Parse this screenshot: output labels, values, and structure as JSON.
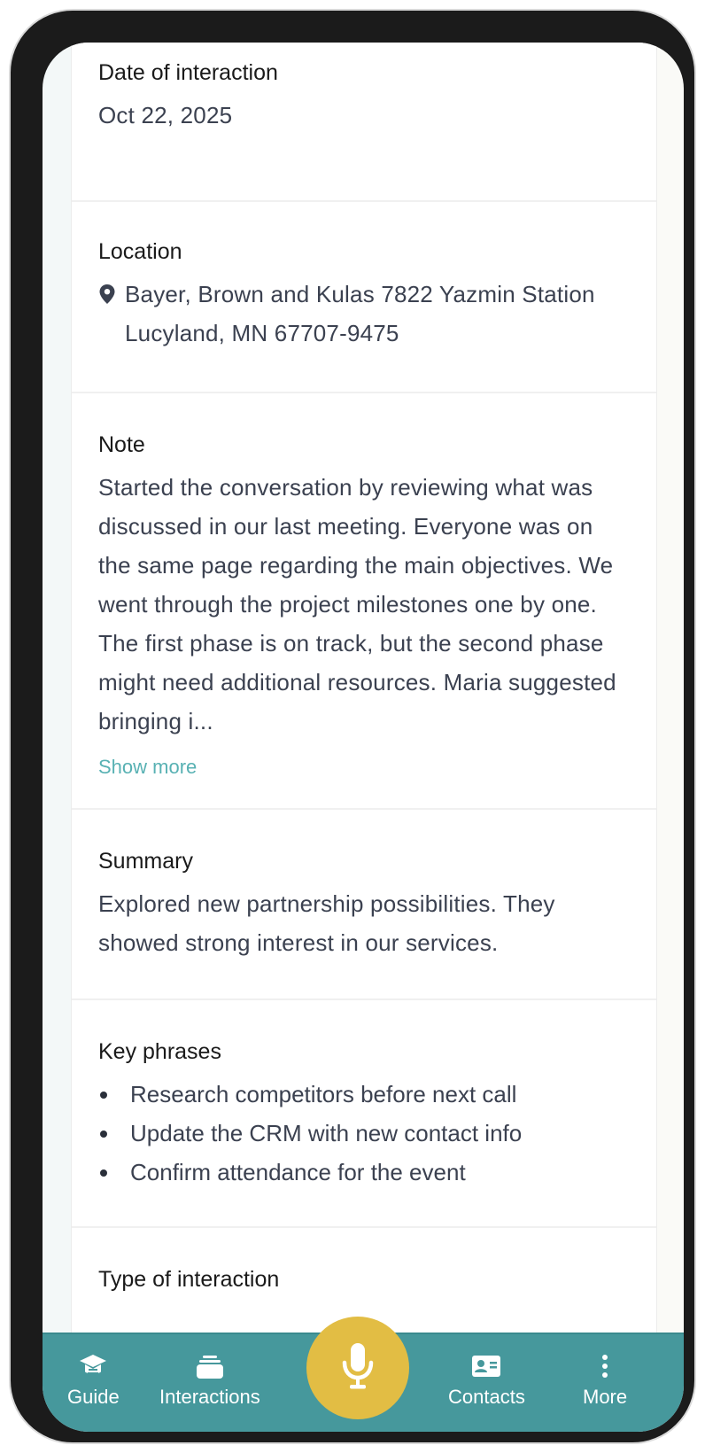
{
  "details": {
    "date_label": "Date of interaction",
    "date_value": "Oct 22, 2025",
    "location_label": "Location",
    "location_line1": "Bayer, Brown and Kulas 7822 Yazmin Station",
    "location_line2": "Lucyland, MN 67707-9475",
    "note_label": "Note",
    "note_text": "Started the conversation by reviewing what was discussed in our last meeting. Everyone was on the same page regarding the main objectives. We went through the project milestones one by one. The first phase is on track, but the second phase might need additional resources. Maria suggested bringing i...",
    "show_more": "Show more",
    "summary_label": "Summary",
    "summary_text": "Explored new partnership possibilities. They showed strong interest in our services.",
    "key_phrases_label": "Key phrases",
    "key_phrases": [
      "Research competitors before next call",
      "Update the CRM with new contact info",
      "Confirm attendance for the event"
    ],
    "type_label": "Type of interaction"
  },
  "nav": {
    "items": [
      {
        "label": "Guide",
        "icon": "graduation-cap-icon"
      },
      {
        "label": "Interactions",
        "icon": "stack-icon"
      },
      {
        "label": "Contacts",
        "icon": "contact-card-icon"
      },
      {
        "label": "More",
        "icon": "more-vertical-icon"
      }
    ],
    "mic_icon": "microphone-icon"
  },
  "colors": {
    "navbar": "#46989c",
    "mic_button": "#e2bd44",
    "link": "#58b1b3"
  }
}
